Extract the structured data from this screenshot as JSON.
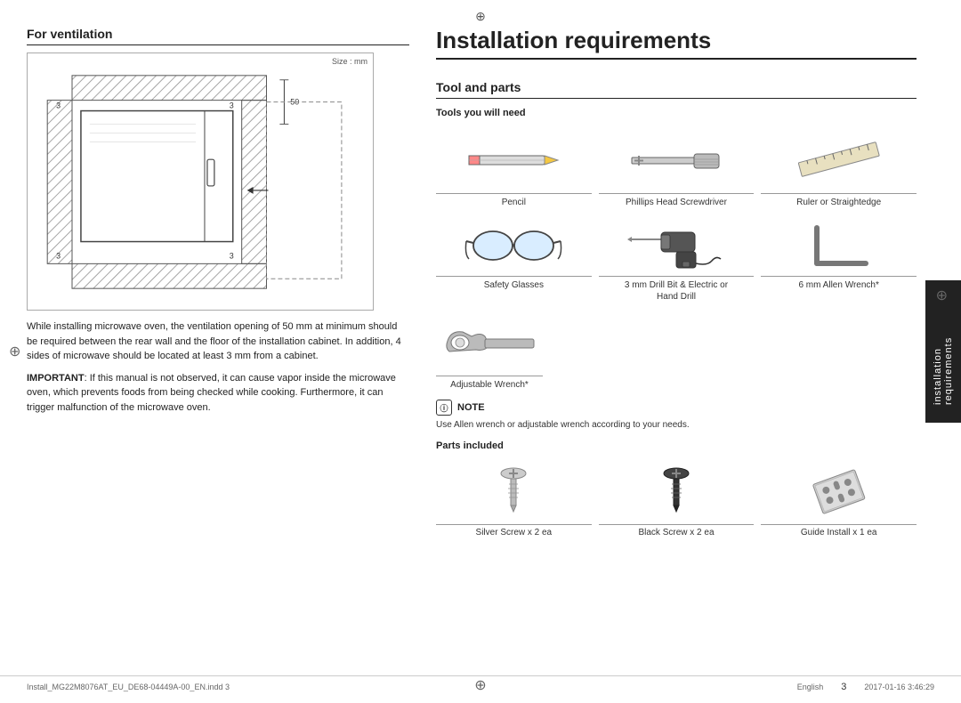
{
  "page": {
    "title": "Installation requirements",
    "language": "English",
    "page_number": "3",
    "footer_left": "Install_MG22M8076AT_EU_DE68-04449A-00_EN.indd   3",
    "footer_right": "2017-01-16   3:46:29"
  },
  "ventilation": {
    "section_title": "For ventilation",
    "size_label": "Size : mm",
    "dimension_50": "50",
    "dimension_3_tl": "3",
    "dimension_3_tr": "3",
    "dimension_3_bl": "3",
    "dimension_3_br": "3",
    "paragraph1": "While installing microwave oven, the ventilation opening of 50 mm at minimum should be required between the rear wall and the floor of the installation cabinet. In addition, 4 sides of microwave should be located at least 3 mm from a cabinet.",
    "important_label": "IMPORTANT",
    "paragraph2": ": If this manual is not observed, it can cause vapor inside the microwave oven, which prevents foods from being checked while cooking. Furthermore, it can trigger malfunction of the microwave oven."
  },
  "tool_and_parts": {
    "section_title": "Tool and parts",
    "tools_subtitle": "Tools you will need",
    "tools": [
      {
        "label": "Pencil"
      },
      {
        "label": "Phillips Head Screwdriver"
      },
      {
        "label": "Ruler or Straightedge"
      },
      {
        "label": "Safety Glasses"
      },
      {
        "label": "3 mm Drill Bit & Electric or\nHand Drill"
      },
      {
        "label": "6 mm Allen Wrench*"
      },
      {
        "label": "Adjustable Wrench*"
      }
    ],
    "note_header": "NOTE",
    "note_text": "Use Allen wrench or adjustable wrench according to your needs.",
    "parts_subtitle": "Parts included",
    "parts": [
      {
        "label": "Silver Screw x 2 ea"
      },
      {
        "label": "Black Screw x 2 ea"
      },
      {
        "label": "Guide Install x 1 ea"
      }
    ]
  },
  "side_tab": {
    "text": "installation requirements"
  }
}
